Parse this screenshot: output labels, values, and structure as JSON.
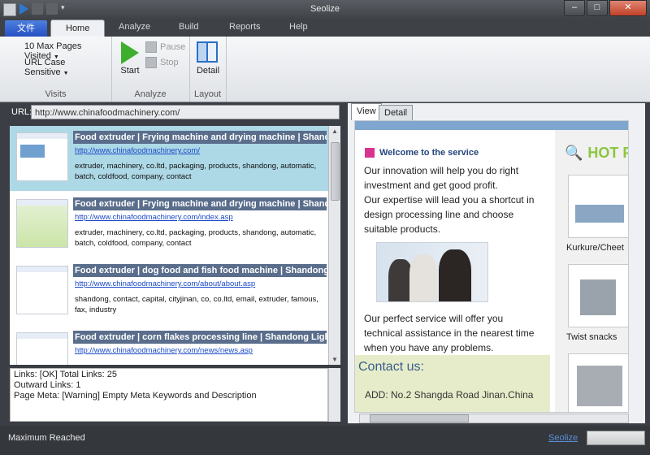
{
  "app": {
    "title": "Seolize"
  },
  "ribbon": {
    "file_tab": "文件",
    "tabs": [
      {
        "label": "Home"
      },
      {
        "label": "Analyze"
      },
      {
        "label": "Build"
      },
      {
        "label": "Reports"
      },
      {
        "label": "Help"
      }
    ],
    "visits": {
      "max_pages": "10 Max Pages Visited",
      "url_case": "URL Case Sensitive",
      "label": "Visits"
    },
    "analyze": {
      "start": "Start",
      "pause": "Pause",
      "stop": "Stop",
      "label": "Analyze"
    },
    "layout": {
      "detail": "Detail",
      "label": "Layout"
    }
  },
  "url": {
    "label": "URL:",
    "value": "http://www.chinafoodmachinery.com/"
  },
  "results": [
    {
      "title": "Food extruder | Frying machine and drying machine | Shandong",
      "url": "http://www.chinafoodmachinery.com/",
      "keywords": "extruder, machinery, co.ltd, packaging, products, shandong, automatic, batch, coldfood, company, contact"
    },
    {
      "title": "Food extruder | Frying machine and drying machine | Shandong",
      "url": "http://www.chinafoodmachinery.com/index.asp",
      "keywords": "extruder, machinery, co.ltd, packaging, products, shandong, automatic, batch, coldfood, company, contact"
    },
    {
      "title": "Food extruder | dog food and fish food machine | Shandong Lig",
      "url": "http://www.chinafoodmachinery.com/about/about.asp",
      "keywords": "shandong, contact, capital, cityjinan, co, co.ltd, email, extruder, famous, fax, industry"
    },
    {
      "title": "Food extruder | corn flakes processing line | Shandong Light M",
      "url": "http://www.chinafoodmachinery.com/news/news.asp",
      "keywords": ""
    }
  ],
  "info": {
    "line1": "Links: [OK] Total Links: 25",
    "line2": "Outward Links: 1",
    "line3": "Page Meta: [Warning] Empty Meta Keywords and Description"
  },
  "view": {
    "tabs": [
      {
        "label": "View"
      },
      {
        "label": "Detail"
      }
    ],
    "welcome": "Welcome to the service",
    "para1": "Our innovation will help you do right investment and get good profit.",
    "para2": "Our expertise will lead you a shortcut in design processing line and choose suitable products.",
    "para3": "Our perfect service will offer you technical assistance in the nearest time when you have any problems.",
    "contact_title": "Contact us:",
    "address": "ADD:     No.2 Shangda Road Jinan.China",
    "hot": "HOT P",
    "products": [
      {
        "label": "Kurkure/Cheet"
      },
      {
        "label": "Twist snacks"
      }
    ]
  },
  "status": {
    "text": "Maximum Reached",
    "link": "Seolize"
  }
}
